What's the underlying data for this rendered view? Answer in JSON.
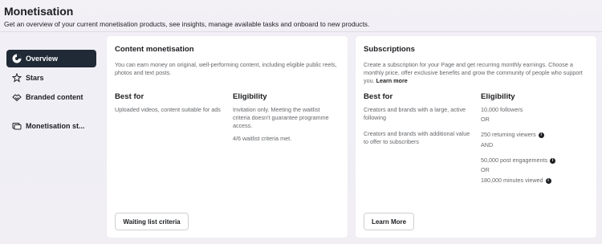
{
  "header": {
    "title": "Monetisation",
    "subtitle": "Get an overview of your current monetisation products, see insights, manage available tasks and onboard to new products."
  },
  "sidebar": {
    "items": [
      {
        "label": "Overview",
        "icon": "overview-icon",
        "active": true
      },
      {
        "label": "Stars",
        "icon": "stars-icon",
        "active": false
      },
      {
        "label": "Branded content",
        "icon": "handshake-icon",
        "active": false
      },
      {
        "label": "Monetisation st...",
        "icon": "monetisation-status-icon",
        "active": false
      }
    ]
  },
  "content_card": {
    "title": "Content monetisation",
    "description": "You can earn money on original, well-performing content, including eligible public reels, photos and text posts.",
    "best_for_heading": "Best for",
    "best_for_text": "Uploaded videos, content suitable for ads",
    "eligibility_heading": "Eligibility",
    "eligibility_text": "Invitation only. Meeting the waitlist criteria doesn't guarantee programme access.",
    "criteria_met": "4/6 waitlist criteria met.",
    "button_label": "Waiting list criteria"
  },
  "subscriptions_card": {
    "title": "Subscriptions",
    "description": "Create a subscription for your Page and get recurring monthly earnings. Choose a monthly price, offer exclusive benefits and grow the community of people who support you.",
    "learn_more_link": "Learn more",
    "best_for_heading": "Best for",
    "best_for_1": "Creators and brands with a large, active following",
    "best_for_2": "Creators and brands with additional value to offer to subscribers",
    "eligibility_heading": "Eligibility",
    "criteria": {
      "followers": "10,000 followers",
      "or_1": "OR",
      "returning_viewers": "250 returning viewers",
      "and": "AND",
      "post_engagements": "50,000 post engagements",
      "or_2": "OR",
      "minutes_viewed": "180,000 minutes viewed"
    },
    "button_label": "Learn More"
  },
  "colors": {
    "active_nav_bg": "#1f2a36",
    "card_bg": "#ffffff",
    "muted_text": "#65676b"
  }
}
